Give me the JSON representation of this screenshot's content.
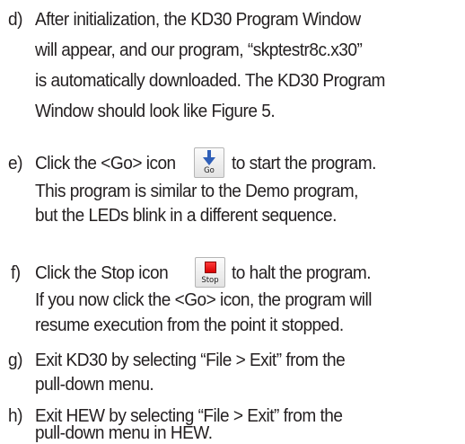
{
  "steps": [
    {
      "marker": "d)",
      "lines": [
        "After initialization, the KD30 Program Window",
        "will appear, and our program, “skptestr8c.x30”",
        "is automatically downloaded. The KD30 Program",
        "Window should look like Figure 5."
      ]
    },
    {
      "marker": "e)",
      "line1_before": "Click the <Go> icon",
      "line1_after": "to start the program.",
      "lines": [
        "This program is similar to the Demo program,",
        "but the LEDs blink in a different sequence."
      ],
      "icon_label": "Go",
      "icon": "go-arrow-icon"
    },
    {
      "marker": "f)",
      "line1_before": "Click the Stop icon",
      "line1_after": "to halt the program.",
      "lines": [
        "If you now click the <Go> icon, the program will",
        "resume execution from the point it stopped."
      ],
      "icon_label": "Stop",
      "icon": "stop-square-icon"
    },
    {
      "marker": "g)",
      "lines": [
        "Exit KD30 by selecting “File > Exit” from the",
        "pull-down menu."
      ]
    },
    {
      "marker": "h)",
      "lines": [
        "Exit HEW by selecting “File > Exit” from the",
        "pull-down menu in HEW."
      ]
    }
  ],
  "colors": {
    "text": "#231f20",
    "go_arrow": "#2f5fb8",
    "stop_square": "#e00000"
  }
}
